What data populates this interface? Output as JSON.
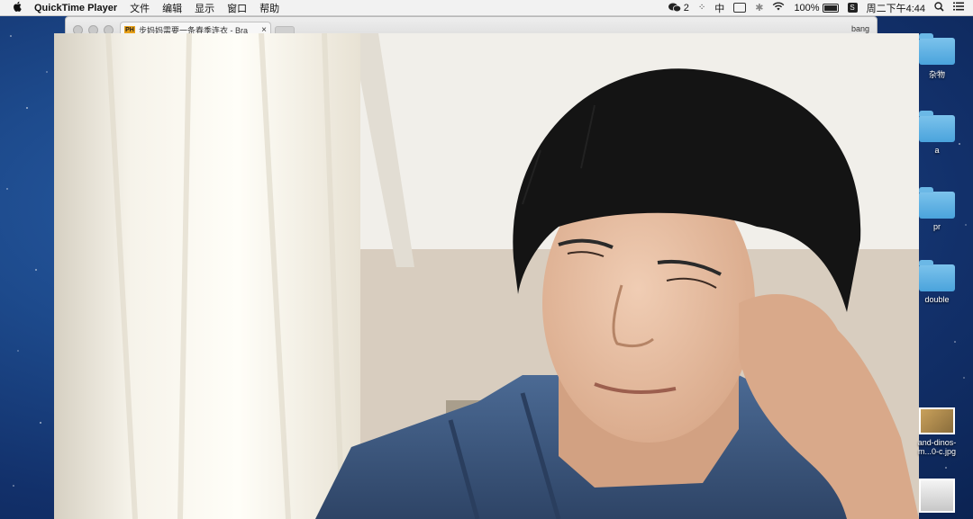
{
  "menubar": {
    "apple": "",
    "app_name": "QuickTime Player",
    "menus": [
      "文件",
      "编辑",
      "显示",
      "窗口",
      "帮助"
    ],
    "wechat_count": "2",
    "input_method": "中",
    "battery_percent": "100%",
    "clock": "周二下午4:44"
  },
  "browser": {
    "tab_favicon": "PH",
    "tab_title": "步妈妈需要一条春季连衣 - Bra",
    "close_glyph": "×",
    "user_name": "bang"
  },
  "desktop": {
    "items": [
      {
        "label": "杂物",
        "type": "folder"
      },
      {
        "label": "a",
        "type": "folder"
      },
      {
        "label": "pr",
        "type": "folder"
      },
      {
        "label": "double",
        "type": "folder"
      },
      {
        "label": "and-dinos-m...0-c.jpg",
        "type": "image"
      },
      {
        "label": "",
        "type": "image"
      }
    ]
  },
  "icons": {
    "apple": "apple-icon",
    "wechat": "wechat-icon",
    "wifi": "wifi-icon",
    "search": "search-icon",
    "menu": "list-icon"
  }
}
